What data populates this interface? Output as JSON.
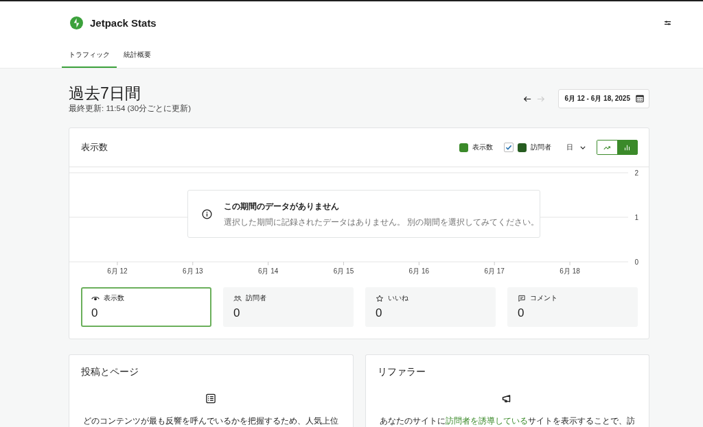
{
  "header": {
    "title": "Jetpack Stats"
  },
  "tabs": [
    {
      "label": "トラフィック",
      "selected": true
    },
    {
      "label": "統計概要",
      "selected": false
    }
  ],
  "period": {
    "title": "過去7日間",
    "updated": "最終更新: 11:54 (30分ごとに更新)",
    "date_range": "6月 12 - 6月 18, 2025"
  },
  "nav_buttons": [
    {
      "kind": "prev",
      "disabled": false
    },
    {
      "kind": "next",
      "disabled": true
    }
  ],
  "chart_card": {
    "title": "表示数",
    "legend": [
      {
        "kind": "plain",
        "label": "表示数",
        "color": "#3b8a2a"
      },
      {
        "kind": "checkbox",
        "label": "訪問者",
        "color": "#265c20",
        "checked": true
      }
    ],
    "interval": "日",
    "chart_types": [
      {
        "kind": "line",
        "selected": false
      },
      {
        "kind": "bar",
        "selected": true
      }
    ],
    "notice": {
      "title": "この期間のデータがありません",
      "text": "選択した期間に記録されたデータはありません。 別の期間を選択してみてください。"
    },
    "chart_data": {
      "type": "bar",
      "categories": [
        "6月 12",
        "6月 13",
        "6月 14",
        "6月 15",
        "6月 16",
        "6月 17",
        "6月 18"
      ],
      "ylim": [
        0,
        2
      ],
      "yticks": [
        0,
        1,
        2
      ]
    }
  },
  "stats": [
    {
      "kind": "views",
      "label": "表示数",
      "value": "0",
      "selected": true
    },
    {
      "kind": "visitors",
      "label": "訪問者",
      "value": "0",
      "selected": false
    },
    {
      "kind": "likes",
      "label": "いいね",
      "value": "0",
      "selected": false
    },
    {
      "kind": "comments",
      "label": "コメント",
      "value": "0",
      "selected": false
    }
  ],
  "panels": [
    {
      "kind": "posts",
      "title": "投稿とページ",
      "parts": [
        {
          "text": "どのコンテンツが最も反響を呼んでいるかを把握するため、人気上位",
          "link": false
        }
      ]
    },
    {
      "kind": "referrers",
      "title": "リファラー",
      "parts": [
        {
          "text": "あなたのサイトに",
          "link": false
        },
        {
          "text": "訪問者を誘導している",
          "link": true
        },
        {
          "text": "サイトを表示することで、訪",
          "link": false
        }
      ]
    }
  ]
}
